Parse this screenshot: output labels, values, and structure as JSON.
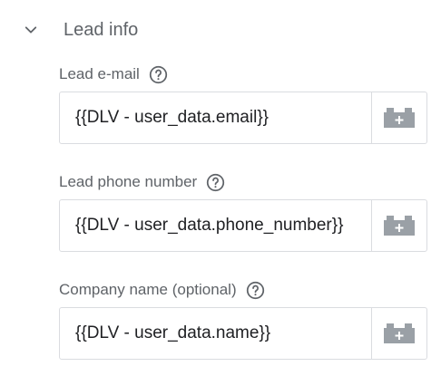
{
  "section": {
    "title": "Lead info"
  },
  "fields": [
    {
      "label": "Lead e-mail",
      "value": "{{DLV - user_data.email}}"
    },
    {
      "label": "Lead phone number",
      "value": "{{DLV - user_data.phone_number}}"
    },
    {
      "label": "Company name (optional)",
      "value": "{{DLV - user_data.name}}"
    }
  ],
  "icons": {
    "collapse": "chevron-down-icon",
    "help": "help-circle-icon",
    "variable": "lego-brick-plus-icon"
  },
  "colors": {
    "label": "#5f6368",
    "text": "#202124",
    "border": "#dadce0",
    "icon": "#9aa0a6"
  }
}
